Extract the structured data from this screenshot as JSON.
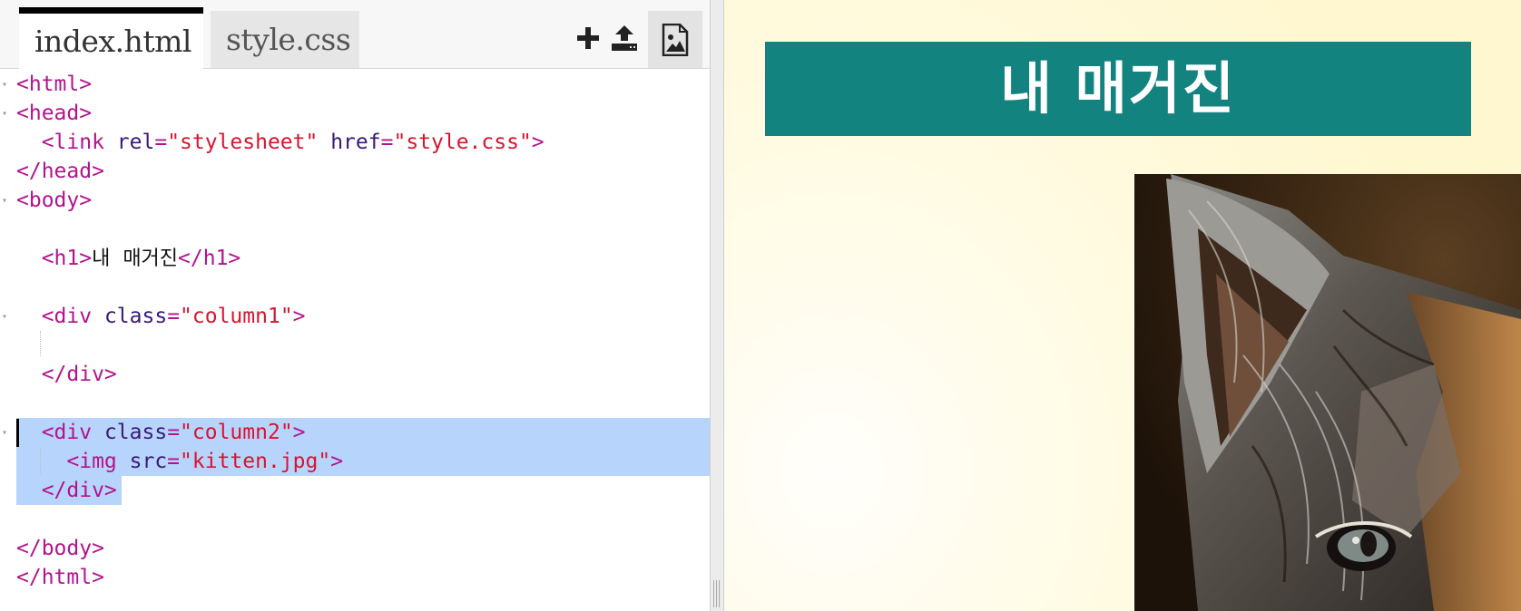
{
  "editor": {
    "tabs": [
      {
        "label": "index.html",
        "active": true
      },
      {
        "label": "style.css",
        "active": false
      }
    ],
    "toolbar": {
      "add_icon": "plus-icon",
      "upload_icon": "upload-icon",
      "image_icon": "image-icon"
    },
    "code_lines": [
      [
        "<html>"
      ],
      [
        "<head>"
      ],
      [
        "  <link",
        " rel",
        "=",
        "\"stylesheet\"",
        " href",
        "=",
        "\"style.css\"",
        ">"
      ],
      [
        "</head>"
      ],
      [
        "<body>"
      ],
      [
        ""
      ],
      [
        "  <h1>",
        "내  매거진",
        "</h1>"
      ],
      [
        ""
      ],
      [
        "  <div",
        " class",
        "=",
        "\"column1\"",
        ">"
      ],
      [
        ""
      ],
      [
        "  </div>"
      ],
      [
        ""
      ],
      [
        "  <div",
        " class",
        "=",
        "\"column2\"",
        ">"
      ],
      [
        "    <img",
        " src",
        "=",
        "\"kitten.jpg\"",
        ">"
      ],
      [
        "  </div>"
      ],
      [
        ""
      ],
      [
        "</body>"
      ],
      [
        "</html>"
      ]
    ]
  },
  "preview": {
    "heading": "내 매거진",
    "banner_color": "#138380",
    "image": "kitten-photo"
  },
  "colors": {
    "tag": "#b3138e",
    "attribute": "#3a1878",
    "string": "#d9142f",
    "selection": "#b7d5fc"
  }
}
